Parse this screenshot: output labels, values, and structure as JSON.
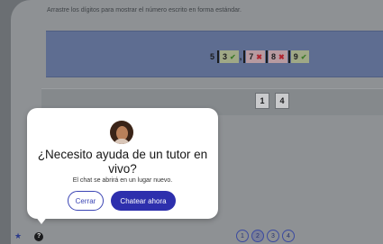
{
  "instructions": "Arrastre los dígitos para mostrar el número escrito en forma estándar.",
  "problem": {
    "leading_digit": "5",
    "slots": [
      {
        "digit": "3",
        "status": "correct",
        "mark": "✔"
      },
      {
        "digit": "7",
        "status": "wrong",
        "mark": "✖"
      },
      {
        "digit": "8",
        "status": "wrong",
        "mark": "✖"
      },
      {
        "digit": "9",
        "status": "correct",
        "mark": "✔"
      }
    ],
    "comma": ","
  },
  "digit_bank": [
    "1",
    "4"
  ],
  "pager": [
    "1",
    "2",
    "3",
    "4"
  ],
  "popup": {
    "title": "¿Necesito ayuda de un tutor en vivo?",
    "subtitle": "El chat se abrirá en un lugar nuevo.",
    "cancel_label": "Cerrar",
    "confirm_label": "Chatear ahora"
  },
  "icons": {
    "help": "?",
    "accessibility": "accessibility-icon"
  },
  "colors": {
    "correct_mark": "#3d7a2a",
    "wrong_mark": "#b0242f",
    "primary_button": "#2d2fad"
  }
}
